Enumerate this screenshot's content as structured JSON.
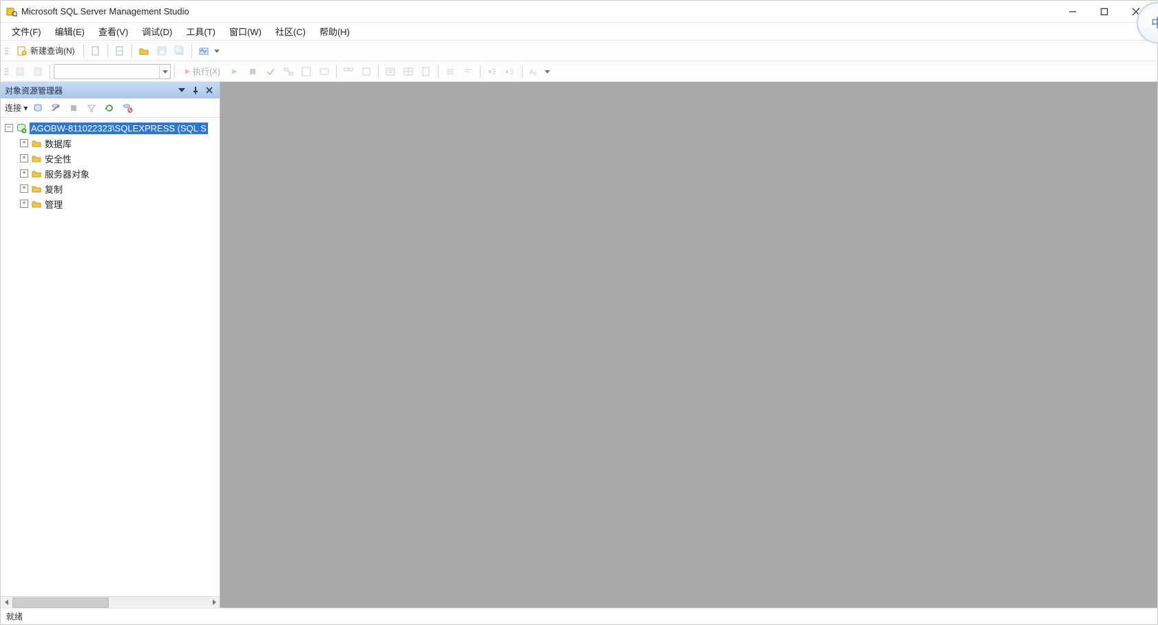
{
  "titlebar": {
    "title": "Microsoft SQL Server Management Studio"
  },
  "menubar": {
    "items": [
      "文件(F)",
      "编辑(E)",
      "查看(V)",
      "调试(D)",
      "工具(T)",
      "窗口(W)",
      "社区(C)",
      "帮助(H)"
    ]
  },
  "toolbar1": {
    "new_query": "新建查询(N)"
  },
  "toolbar2": {
    "execute": "执行(X)"
  },
  "panel": {
    "title": "对象资源管理器",
    "connect_label": "连接 ▾"
  },
  "tree": {
    "root": {
      "expander": "−",
      "label": "AGOBW-811022323\\SQLEXPRESS (SQL S"
    },
    "children": [
      {
        "expander": "+",
        "label": "数据库"
      },
      {
        "expander": "+",
        "label": "安全性"
      },
      {
        "expander": "+",
        "label": "服务器对象"
      },
      {
        "expander": "+",
        "label": "复制"
      },
      {
        "expander": "+",
        "label": "管理"
      }
    ]
  },
  "statusbar": {
    "text": "就绪"
  },
  "ime": {
    "label": "中"
  }
}
